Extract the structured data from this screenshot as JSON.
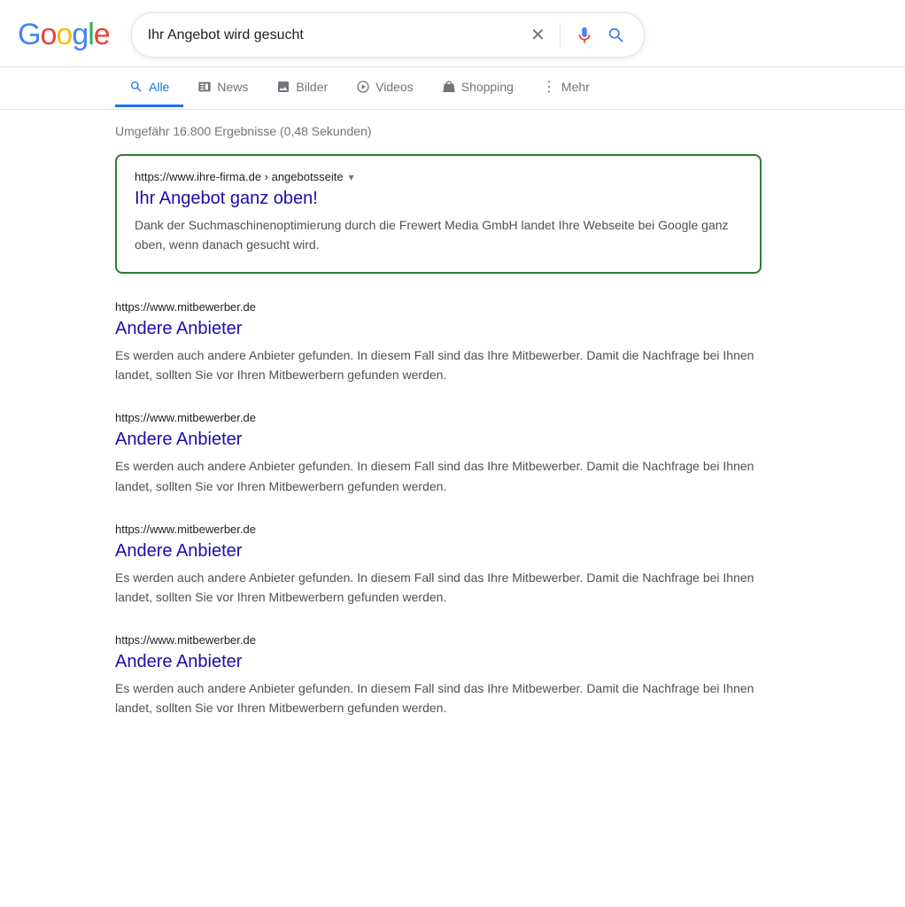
{
  "header": {
    "logo": {
      "letters": [
        {
          "char": "G",
          "color": "blue"
        },
        {
          "char": "o",
          "color": "red"
        },
        {
          "char": "o",
          "color": "yellow"
        },
        {
          "char": "g",
          "color": "blue"
        },
        {
          "char": "l",
          "color": "green"
        },
        {
          "char": "e",
          "color": "red"
        }
      ]
    },
    "search_query": "Ihr Angebot wird gesucht",
    "clear_button_label": "×",
    "mic_label": "voice search",
    "search_button_label": "search"
  },
  "nav": {
    "tabs": [
      {
        "id": "alle",
        "label": "Alle",
        "active": true
      },
      {
        "id": "news",
        "label": "News",
        "active": false
      },
      {
        "id": "bilder",
        "label": "Bilder",
        "active": false
      },
      {
        "id": "videos",
        "label": "Videos",
        "active": false
      },
      {
        "id": "shopping",
        "label": "Shopping",
        "active": false
      },
      {
        "id": "mehr",
        "label": "Mehr",
        "active": false
      }
    ]
  },
  "results": {
    "info": "Umgefähr 16.800 Ergebnisse (0,48 Sekunden)",
    "items": [
      {
        "id": "featured",
        "featured": true,
        "url": "https://www.ihre-firma.de › angebotsseite",
        "title": "Ihr Angebot ganz oben!",
        "description": "Dank der Suchmaschinenoptimierung durch die Frewert Media GmbH landet Ihre Webseite bei Google ganz oben, wenn danach gesucht wird."
      },
      {
        "id": "competitor1",
        "featured": false,
        "url": "https://www.mitbewerber.de",
        "title": "Andere Anbieter",
        "description": "Es werden auch andere Anbieter gefunden. In diesem Fall sind das Ihre Mitbewerber. Damit die Nachfrage bei Ihnen landet, sollten Sie vor Ihren Mitbewerbern gefunden werden."
      },
      {
        "id": "competitor2",
        "featured": false,
        "url": "https://www.mitbewerber.de",
        "title": "Andere Anbieter",
        "description": "Es werden auch andere Anbieter gefunden. In diesem Fall sind das Ihre Mitbewerber. Damit die Nachfrage bei Ihnen landet, sollten Sie vor Ihren Mitbewerbern gefunden werden."
      },
      {
        "id": "competitor3",
        "featured": false,
        "url": "https://www.mitbewerber.de",
        "title": "Andere Anbieter",
        "description": "Es werden auch andere Anbieter gefunden. In diesem Fall sind das Ihre Mitbewerber. Damit die Nachfrage bei Ihnen landet, sollten Sie vor Ihren Mitbewerbern gefunden werden."
      },
      {
        "id": "competitor4",
        "featured": false,
        "url": "https://www.mitbewerber.de",
        "title": "Andere Anbieter",
        "description": "Es werden auch andere Anbieter gefunden. In diesem Fall sind das Ihre Mitbewerber. Damit die Nachfrage bei Ihnen landet, sollten Sie vor Ihren Mitbewerbern gefunden werden."
      }
    ]
  },
  "colors": {
    "blue": "#4285F4",
    "red": "#EA4335",
    "yellow": "#FBBC05",
    "green": "#34A853",
    "link_blue": "#1a0dab",
    "active_tab": "#1a73e8",
    "featured_border": "#2e7d32"
  }
}
